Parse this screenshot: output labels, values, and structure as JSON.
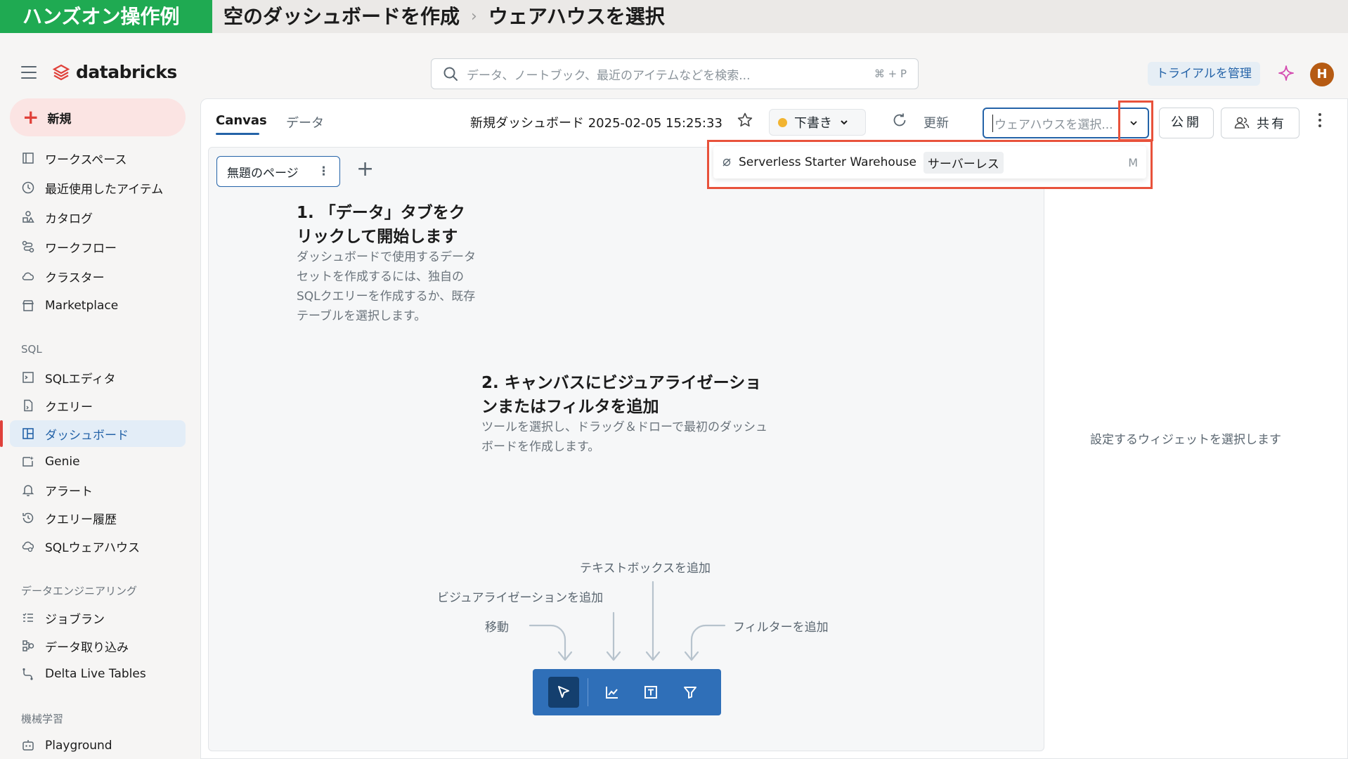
{
  "banner": {
    "tag": "ハンズオン操作例",
    "crumb1": "空のダッシュボードを作成",
    "sep": "›",
    "crumb2": "ウェアハウスを選択"
  },
  "header": {
    "logo_text": "databricks",
    "search_placeholder": "データ、ノートブック、最近のアイテムなどを検索...",
    "search_shortcut": "⌘ + P",
    "trial_button": "トライアルを管理",
    "avatar_initial": "H"
  },
  "sidebar": {
    "new_button": "新規",
    "items_top": [
      {
        "label": "ワークスペース",
        "icon": "workspace-icon"
      },
      {
        "label": "最近使用したアイテム",
        "icon": "clock-icon"
      },
      {
        "label": "カタログ",
        "icon": "catalog-icon"
      },
      {
        "label": "ワークフロー",
        "icon": "workflow-icon"
      },
      {
        "label": "クラスター",
        "icon": "cloud-icon"
      },
      {
        "label": "Marketplace",
        "icon": "store-icon"
      }
    ],
    "section_sql": "SQL",
    "items_sql": [
      {
        "label": "SQLエディタ",
        "icon": "sql-editor-icon"
      },
      {
        "label": "クエリー",
        "icon": "query-icon"
      },
      {
        "label": "ダッシュボード",
        "icon": "dashboard-icon",
        "active": true
      },
      {
        "label": "Genie",
        "icon": "genie-icon"
      },
      {
        "label": "アラート",
        "icon": "bell-icon"
      },
      {
        "label": "クエリー履歴",
        "icon": "history-icon"
      },
      {
        "label": "SQLウェアハウス",
        "icon": "warehouse-icon"
      }
    ],
    "section_de": "データエンジニアリング",
    "items_de": [
      {
        "label": "ジョブラン",
        "icon": "job-runs-icon"
      },
      {
        "label": "データ取り込み",
        "icon": "ingest-icon"
      },
      {
        "label": "Delta Live Tables",
        "icon": "pipeline-icon"
      }
    ],
    "section_ml": "機械学習",
    "items_ml": [
      {
        "label": "Playground",
        "icon": "playground-icon"
      }
    ]
  },
  "toolbar": {
    "tab_canvas": "Canvas",
    "tab_data": "データ",
    "dashboard_title": "新規ダッシュボード 2025-02-05 15:25:33",
    "draft_label": "下書き",
    "refresh_label": "更新",
    "warehouse_placeholder": "ウェアハウスを選択...",
    "publish_label": "公開",
    "share_label": "共有"
  },
  "canvas": {
    "page_tab": "無題のページ",
    "step1_title": "1. 「データ」タブをクリックして開始します",
    "step1_desc": "ダッシュボードで使用するデータセットを作成するには、独自のSQLクエリーを作成するか、既存テーブルを選択します。",
    "step2_title": "2. キャンバスにビジュアライゼーションまたはフィルタを追加",
    "step2_desc": "ツールを選択し、ドラッグ＆ドローで最初のダッシュボードを作成します。",
    "hint_move": "移動",
    "hint_viz": "ビジュアライゼーションを追加",
    "hint_text": "テキストボックスを追加",
    "hint_filter": "フィルターを追加"
  },
  "right_panel": {
    "hint": "設定するウィジェットを選択します"
  },
  "dropdown": {
    "warehouse_name": "Serverless Starter Warehouse",
    "badge": "サーバーレス",
    "size": "M"
  },
  "colors": {
    "accent": "#2463a8",
    "brand_red": "#e0413a",
    "highlight": "#e8523b",
    "banner_green": "#1faa52",
    "toolbar_blue": "#2f6fb8"
  }
}
